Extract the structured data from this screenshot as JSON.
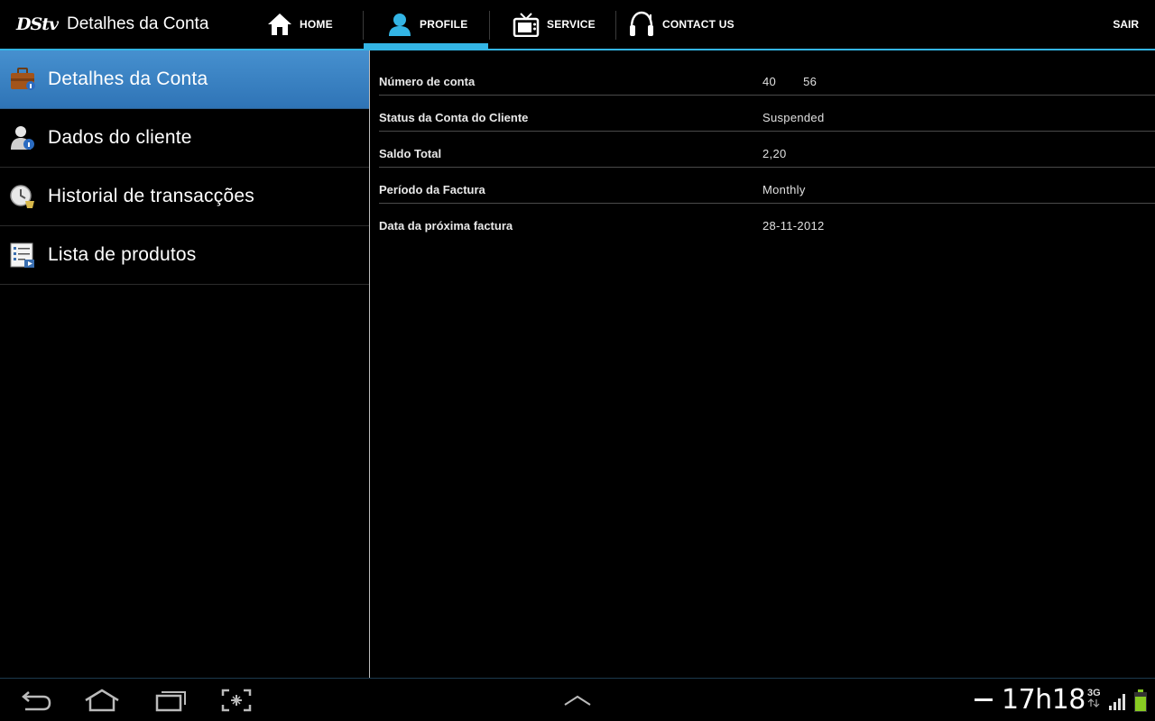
{
  "app": {
    "logo_text": "DStv",
    "title": "Detalhes da Conta"
  },
  "tabs": [
    {
      "label": "HOME",
      "icon": "home-icon",
      "selected": false
    },
    {
      "label": "PROFILE",
      "icon": "person-icon",
      "selected": true
    },
    {
      "label": "SERVICE",
      "icon": "tv-icon",
      "selected": false
    },
    {
      "label": "CONTACT US",
      "icon": "headset-icon",
      "selected": false
    }
  ],
  "logout_label": "SAIR",
  "accent_color": "#33b5e5",
  "selected_item_color": "#3a83c4",
  "sidebar": {
    "items": [
      {
        "label": "Detalhes da Conta",
        "icon": "briefcase-info-icon",
        "selected": true
      },
      {
        "label": "Dados do cliente",
        "icon": "user-info-icon",
        "selected": false
      },
      {
        "label": "Historial de transacções",
        "icon": "clock-history-icon",
        "selected": false
      },
      {
        "label": "Lista de produtos",
        "icon": "product-list-icon",
        "selected": false
      }
    ]
  },
  "details": {
    "rows": [
      {
        "label": "Número de conta",
        "value_start": "40",
        "value_end": "56"
      },
      {
        "label": "Status da Conta do Cliente",
        "value": "Suspended"
      },
      {
        "label": "Saldo Total",
        "value": "2,20"
      },
      {
        "label": "Período da Factura",
        "value": "Monthly"
      },
      {
        "label": "Data da próxima factura",
        "value": "28-11-2012"
      }
    ]
  },
  "system_bar": {
    "time": "17h18",
    "network": "3G",
    "buttons": [
      "back-icon",
      "home-icon",
      "recent-apps-icon",
      "screenshot-icon",
      "chevron-up-icon"
    ]
  }
}
